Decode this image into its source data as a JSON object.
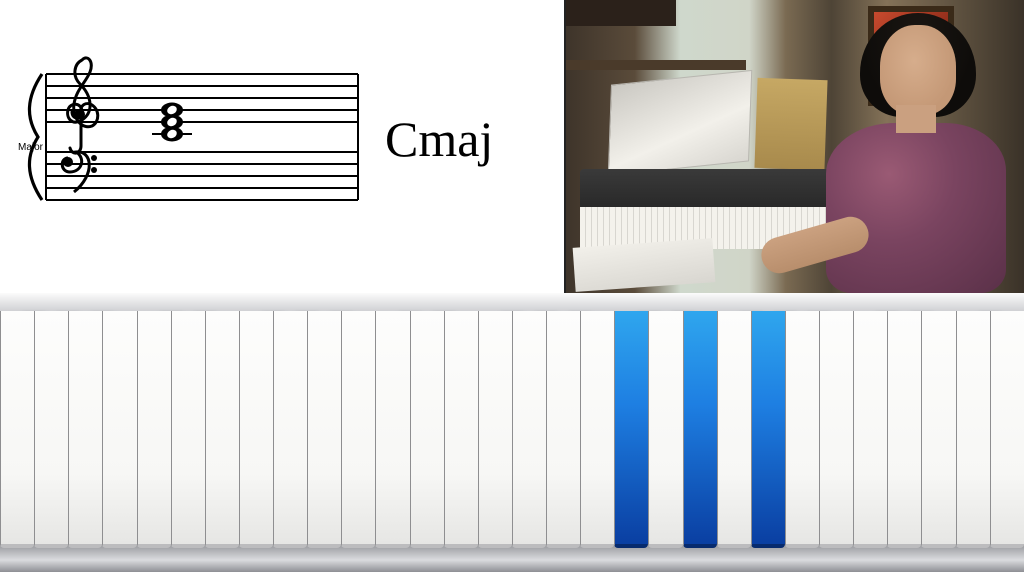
{
  "notation": {
    "chord_label": "Cmaj",
    "scale_label": "Major",
    "chord_notes": [
      "C4",
      "E4",
      "G4"
    ],
    "clef_top": "treble",
    "clef_bottom": "bass"
  },
  "keyboard": {
    "start_note": "F1",
    "white_key_count": 30,
    "highlighted_white": [
      "C4",
      "E4",
      "G4"
    ],
    "highlight_color": "#1e7fe2"
  },
  "video": {
    "description": "instructor-at-digital-piano"
  }
}
